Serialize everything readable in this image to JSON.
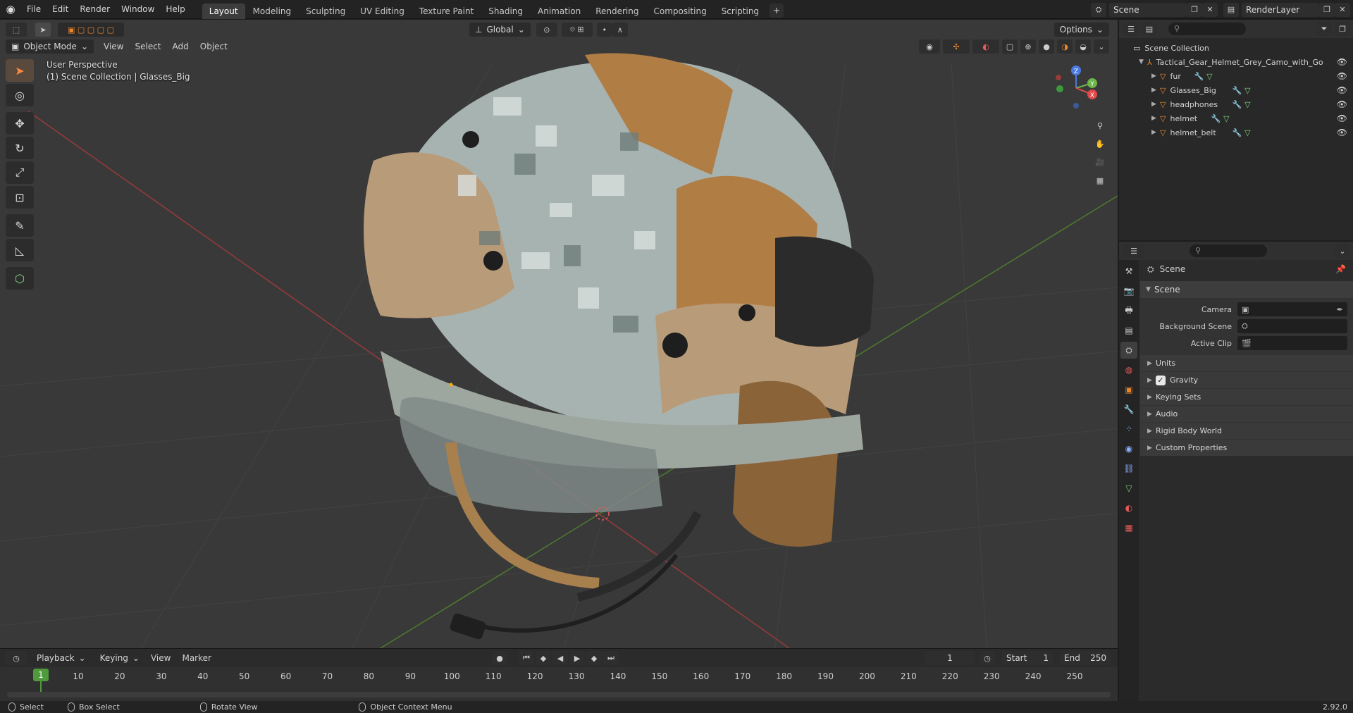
{
  "topbar": {
    "menus": [
      "File",
      "Edit",
      "Render",
      "Window",
      "Help"
    ],
    "workspace_tabs": [
      "Layout",
      "Modeling",
      "Sculpting",
      "UV Editing",
      "Texture Paint",
      "Shading",
      "Animation",
      "Rendering",
      "Compositing",
      "Scripting"
    ],
    "active_tab": "Layout",
    "scene_name": "Scene",
    "view_layer": "RenderLayer"
  },
  "viewport": {
    "mode": "Object Mode",
    "menus": [
      "View",
      "Select",
      "Add",
      "Object"
    ],
    "orientation": "Global",
    "options_label": "Options",
    "info_line1": "User Perspective",
    "info_line2": "(1) Scene Collection | Glasses_Big",
    "gizmo": {
      "x": "X",
      "y": "Y",
      "z": "Z"
    }
  },
  "outliner": {
    "root": "Scene Collection",
    "collection": "Tactical_Gear_Helmet_Grey_Camo_with_Go",
    "objects": [
      "fur",
      "Glasses_Big",
      "headphones",
      "helmet",
      "helmet_belt"
    ]
  },
  "properties": {
    "context": "Scene",
    "section": "Scene",
    "fields": {
      "camera_label": "Camera",
      "background_label": "Background Scene",
      "active_clip_label": "Active Clip"
    },
    "subsections": [
      "Units",
      "Gravity",
      "Keying Sets",
      "Audio",
      "Rigid Body World",
      "Custom Properties"
    ],
    "gravity_checked": true
  },
  "timeline": {
    "menus": [
      "Playback",
      "Keying",
      "View",
      "Marker"
    ],
    "current_frame": "1",
    "start_label": "Start",
    "start_value": "1",
    "end_label": "End",
    "end_value": "250",
    "ticks": [
      "1",
      "10",
      "20",
      "30",
      "40",
      "50",
      "60",
      "70",
      "80",
      "90",
      "100",
      "110",
      "120",
      "130",
      "140",
      "150",
      "160",
      "170",
      "180",
      "190",
      "200",
      "210",
      "220",
      "230",
      "240",
      "250"
    ]
  },
  "statusbar": {
    "select": "Select",
    "box_select": "Box Select",
    "rotate_view": "Rotate View",
    "context_menu": "Object Context Menu",
    "version": "2.92.0"
  },
  "colors": {
    "accent": "#e8872f",
    "active_frame": "#4f9a3b",
    "viewport_bg": "#393939"
  }
}
